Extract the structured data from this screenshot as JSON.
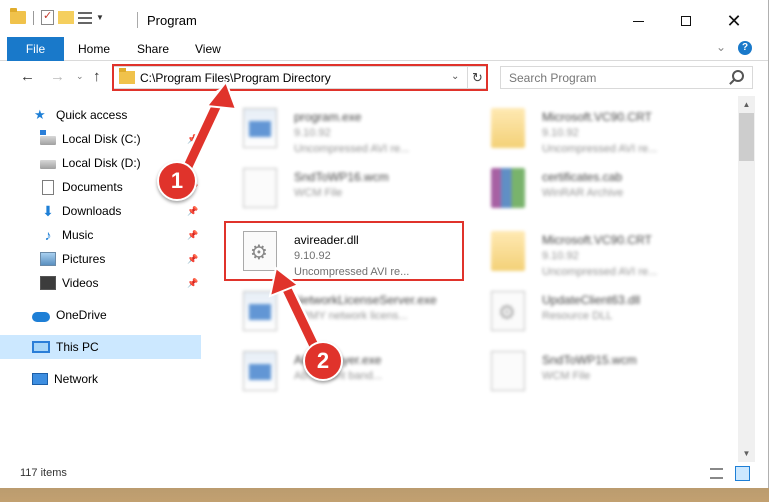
{
  "window": {
    "title": "Program"
  },
  "ribbon": {
    "file_label": "File",
    "home_label": "Home",
    "share_label": "Share",
    "view_label": "View"
  },
  "navigation": {
    "address_path": "C:\\Program Files\\Program Directory",
    "search_placeholder": "Search Program"
  },
  "sidebar": {
    "items": [
      {
        "label": "Quick access",
        "icon": "star-icon",
        "pinned": false
      },
      {
        "label": "Local Disk (C:)",
        "icon": "disk-icon",
        "pinned": true
      },
      {
        "label": "Local Disk (D:)",
        "icon": "disk-icon",
        "pinned": true
      },
      {
        "label": "Documents",
        "icon": "document-icon",
        "pinned": true
      },
      {
        "label": "Downloads",
        "icon": "download-icon",
        "pinned": true
      },
      {
        "label": "Music",
        "icon": "music-icon",
        "pinned": true
      },
      {
        "label": "Pictures",
        "icon": "picture-icon",
        "pinned": true
      },
      {
        "label": "Videos",
        "icon": "video-icon",
        "pinned": true
      },
      {
        "label": "OneDrive",
        "icon": "cloud-icon",
        "pinned": false
      },
      {
        "label": "This PC",
        "icon": "computer-icon",
        "pinned": false,
        "selected": true
      },
      {
        "label": "Network",
        "icon": "network-icon",
        "pinned": false
      }
    ]
  },
  "files": [
    {
      "name": "program.exe",
      "line1": "9.10.92",
      "line2": "Uncompressed AVI re...",
      "icon": "exe-icon",
      "blurred": true
    },
    {
      "name": "Microsoft.VC90.CRT",
      "line1": "9.10.92",
      "line2": "Uncompressed AVI re...",
      "icon": "folder-icon",
      "blurred": true
    },
    {
      "name": "SndToWP16.wcm",
      "line1": "WCM File",
      "line2": "",
      "icon": "file-icon",
      "blurred": true
    },
    {
      "name": "certificates.cab",
      "line1": "WinRAR Archive",
      "line2": "",
      "icon": "rar-icon",
      "blurred": true
    },
    {
      "name": "avireader.dll",
      "line1": "9.10.92",
      "line2": "Uncompressed AVI re...",
      "icon": "dll-icon",
      "blurred": false
    },
    {
      "name": "Microsoft.VC90.CRT",
      "line1": "9.10.92",
      "line2": "Uncompressed AVI re...",
      "icon": "folder-icon",
      "blurred": true
    },
    {
      "name": "NetworkLicenseServer.exe",
      "line1": "ARMY network licens...",
      "line2": "",
      "icon": "exe-icon",
      "blurred": true
    },
    {
      "name": "UpdateClient63.dll",
      "line1": "Resource DLL",
      "line2": "",
      "icon": "dll-icon",
      "blurred": true
    },
    {
      "name": "AboutPlayer.exe",
      "line1": "Ab... client band...",
      "line2": "",
      "icon": "exe-icon",
      "blurred": true
    },
    {
      "name": "SndToWP15.wcm",
      "line1": "WCM File",
      "line2": "",
      "icon": "file-icon",
      "blurred": true
    }
  ],
  "status": {
    "item_count": "117 items"
  },
  "annotations": {
    "badge_1": "1",
    "badge_2": "2",
    "color": "#e0332b"
  },
  "colors": {
    "accent": "#1979ca",
    "selection": "#cce8ff"
  }
}
